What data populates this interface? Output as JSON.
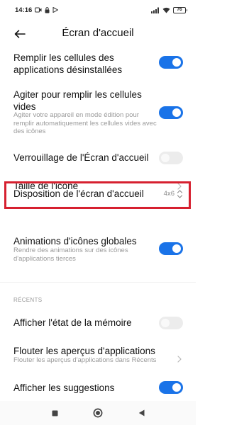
{
  "status_bar": {
    "time": "14:16",
    "battery": "76"
  },
  "header": {
    "title": "Écran d'accueil"
  },
  "settings": [
    {
      "title": "Remplir les cellules des applications désinstallées",
      "control": "toggle",
      "state": "on"
    },
    {
      "title": "Agiter pour remplir les cellules vides",
      "description": "Agiter votre appareil en mode édition pour remplir automatiquement les cellules vides avec des icônes",
      "control": "toggle",
      "state": "on"
    },
    {
      "title": "Verrouillage de l'Écran d'accueil",
      "control": "toggle",
      "state": "off"
    },
    {
      "title": "Taille de l'icône",
      "control": "chevron"
    },
    {
      "title": "Disposition de l'écran d'accueil",
      "value": "4x6",
      "control": "updown"
    },
    {
      "title": "Animations d'icônes globales",
      "description": "Rendre des animations sur des icônes d'applications tierces",
      "control": "toggle",
      "state": "on"
    }
  ],
  "section_recents": {
    "label": "RÉCENTS"
  },
  "recents": [
    {
      "title": "Afficher l'état de la mémoire",
      "control": "toggle",
      "state": "off"
    },
    {
      "title": "Flouter les aperçus d'applications",
      "description": "Flouter les aperçus d'applications dans Récents",
      "control": "chevron"
    },
    {
      "title": "Afficher les suggestions",
      "control": "toggle",
      "state": "on"
    }
  ],
  "colors": {
    "accent": "#1a73e8",
    "highlight": "#d6202f"
  }
}
